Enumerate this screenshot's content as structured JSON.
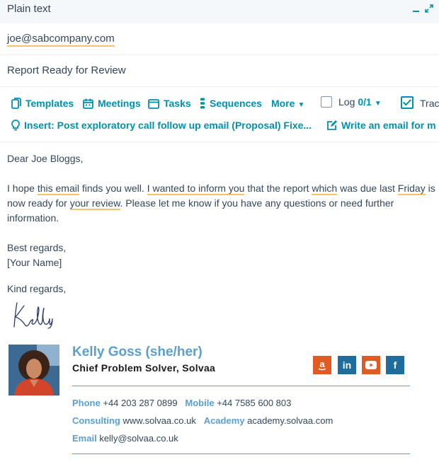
{
  "header": {
    "title": "Plain text"
  },
  "email": {
    "to": "joe@sabcompany.com",
    "subject": "Report Ready for Review"
  },
  "toolbar": {
    "templates": "Templates",
    "meetings": "Meetings",
    "tasks": "Tasks",
    "sequences": "Sequences",
    "more": "More",
    "log_label": "Log",
    "log_count": "0/1",
    "track_label": "Trac",
    "insert": "Insert: Post exploratory call follow up email (Proposal) Fixe...",
    "write": "Write an email for m"
  },
  "body": {
    "greeting": "Dear Joe Bloggs,",
    "p1": {
      "a": "I hope ",
      "b": "this email",
      "c": " finds you well. ",
      "d": "I wanted to inform you",
      "e": " that the report ",
      "f": "which",
      "g": " was due last ",
      "h": "Friday",
      "i": " is now ready for ",
      "j": "your review",
      "k": ". Please let me know if you have any questions or need further information."
    },
    "closing": "Best regards,",
    "placeholder_name": "[Your Name]",
    "kind_regards": "Kind regards,"
  },
  "signature": {
    "handwritten": "Kelly",
    "name": "Kelly Goss (she/her)",
    "title": "Chief Problem Solver, Solvaa",
    "phone_label": "Phone",
    "phone": "+44 203 287 0899",
    "mobile_label": "Mobile",
    "mobile": "+44 7585 600 803",
    "consulting_label": "Consulting",
    "consulting": "www.solvaa.co.uk",
    "academy_label": "Academy",
    "academy": "academy.solvaa.com",
    "email_label": "Email",
    "email": "kelly@solvaa.co.uk",
    "social": [
      "amazon-icon",
      "linkedin-icon",
      "youtube-icon",
      "facebook-icon"
    ],
    "social_glyphs": {
      "linkedin": "in",
      "facebook": "f"
    }
  },
  "colors": {
    "accent": "#0091ae",
    "signature_blue": "#5a9fd4",
    "amazon_orange": "#e05a22",
    "linkedin_blue": "#1f6d9c",
    "underline": "#f5c26b"
  }
}
